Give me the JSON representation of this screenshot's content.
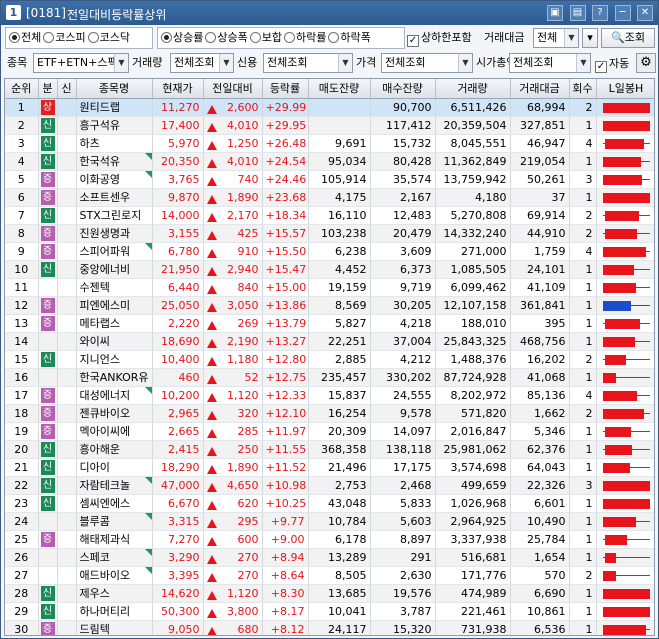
{
  "window": {
    "number": "1",
    "code": "[0181]",
    "title": "전일대비등락률상위",
    "buttons": [
      "▣",
      "▤",
      "?",
      "─",
      "✕"
    ]
  },
  "filters": {
    "market_options": [
      "전체",
      "코스피",
      "코스닥"
    ],
    "market_selected": 0,
    "sort_options": [
      "상승률",
      "상승폭",
      "보합",
      "하락률",
      "하락폭"
    ],
    "sort_selected": 0,
    "include_limit_label": "상하한포함",
    "include_limit_checked": true,
    "trade_amount_label": "거래대금",
    "trade_amount_value": "전체",
    "query_button": "조회",
    "item_label": "종목",
    "item_value": "ETF+ETN+스팩",
    "volume_label": "거래량",
    "volume_value": "전체조회",
    "credit_label": "신용",
    "credit_value": "전체조회",
    "price_label": "가격",
    "price_value": "전체조회",
    "mcap_label": "시가총액",
    "mcap_value": "전체조회",
    "auto_label": "자동",
    "auto_checked": true
  },
  "columns": [
    "순위",
    "분",
    "신",
    "종목명",
    "현재가",
    "전일대비",
    "등락률",
    "매도잔량",
    "매수잔량",
    "거래량",
    "거래대금",
    "회수",
    "L일봉H"
  ],
  "colors": {
    "up": "#e8131b",
    "candle_blue": "#1a4fc9",
    "tag_up": "#e02020",
    "tag_new": "#1b8a5a",
    "tag_mid": "#b65fb0"
  },
  "rows": [
    {
      "rank": "1",
      "tag": "상",
      "tag_kind": "up",
      "name": "원티드랩",
      "price": "11,270",
      "change": "2,600",
      "rate": "+29.99",
      "ask": "",
      "bid": "90,700",
      "volume": "6,511,426",
      "amount": "68,994",
      "count": "2",
      "tri": false,
      "candle": [
        0.05,
        0.98,
        0.05,
        0.98
      ],
      "blue": false
    },
    {
      "rank": "2",
      "tag": "신",
      "tag_kind": "new",
      "name": "흥구석유",
      "price": "17,400",
      "change": "4,010",
      "rate": "+29.95",
      "ask": "",
      "bid": "117,412",
      "volume": "20,359,504",
      "amount": "327,851",
      "count": "1",
      "tri": false,
      "candle": [
        0.05,
        0.98,
        0.05,
        0.98
      ],
      "blue": false
    },
    {
      "rank": "3",
      "tag": "신",
      "tag_kind": "new",
      "name": "하츠",
      "price": "5,970",
      "change": "1,250",
      "rate": "+26.48",
      "ask": "9,691",
      "bid": "15,732",
      "volume": "8,045,551",
      "amount": "46,947",
      "count": "4",
      "tri": false,
      "candle": [
        0.05,
        0.98,
        0.08,
        0.85
      ],
      "blue": false
    },
    {
      "rank": "4",
      "tag": "신",
      "tag_kind": "new",
      "name": "한국석유",
      "price": "20,350",
      "change": "4,010",
      "rate": "+24.54",
      "ask": "95,034",
      "bid": "80,428",
      "volume": "11,362,849",
      "amount": "219,054",
      "count": "1",
      "tri": true,
      "candle": [
        0.05,
        0.98,
        0.05,
        0.8
      ],
      "blue": false
    },
    {
      "rank": "5",
      "tag": "증",
      "tag_kind": "mid",
      "name": "이화공영",
      "price": "3,765",
      "change": "740",
      "rate": "+24.46",
      "ask": "105,914",
      "bid": "35,574",
      "volume": "13,759,942",
      "amount": "50,261",
      "count": "3",
      "tri": true,
      "candle": [
        0.05,
        0.98,
        0.05,
        0.82
      ],
      "blue": false
    },
    {
      "rank": "6",
      "tag": "증",
      "tag_kind": "mid",
      "name": "소프트센우",
      "price": "9,870",
      "change": "1,890",
      "rate": "+23.68",
      "ask": "4,175",
      "bid": "2,167",
      "volume": "4,180",
      "amount": "37",
      "count": "1",
      "tri": false,
      "candle": [
        0.05,
        0.98,
        0.05,
        0.98
      ],
      "blue": false
    },
    {
      "rank": "7",
      "tag": "신",
      "tag_kind": "new",
      "name": "STX그린로지",
      "price": "14,000",
      "change": "2,170",
      "rate": "+18.34",
      "ask": "16,110",
      "bid": "12,483",
      "volume": "5,270,808",
      "amount": "69,914",
      "count": "2",
      "tri": false,
      "candle": [
        0.05,
        0.98,
        0.08,
        0.75
      ],
      "blue": false
    },
    {
      "rank": "8",
      "tag": "증",
      "tag_kind": "mid",
      "name": "진원생명과",
      "price": "3,155",
      "change": "425",
      "rate": "+15.57",
      "ask": "103,238",
      "bid": "20,479",
      "volume": "14,332,240",
      "amount": "44,910",
      "count": "2",
      "tri": false,
      "candle": [
        0.05,
        0.98,
        0.08,
        0.72
      ],
      "blue": false
    },
    {
      "rank": "9",
      "tag": "증",
      "tag_kind": "mid",
      "name": "스피어파워",
      "price": "6,780",
      "change": "910",
      "rate": "+15.50",
      "ask": "6,238",
      "bid": "3,609",
      "volume": "271,000",
      "amount": "1,759",
      "count": "4",
      "tri": true,
      "candle": [
        0.05,
        0.98,
        0.05,
        0.9
      ],
      "blue": false
    },
    {
      "rank": "10",
      "tag": "신",
      "tag_kind": "new",
      "name": "중앙에너비",
      "price": "21,950",
      "change": "2,940",
      "rate": "+15.47",
      "ask": "4,452",
      "bid": "6,373",
      "volume": "1,085,505",
      "amount": "24,101",
      "count": "1",
      "tri": false,
      "candle": [
        0.05,
        0.98,
        0.05,
        0.65
      ],
      "blue": false
    },
    {
      "rank": "11",
      "tag": "",
      "tag_kind": "",
      "name": "수젠텍",
      "price": "6,440",
      "change": "840",
      "rate": "+15.00",
      "ask": "19,159",
      "bid": "9,719",
      "volume": "6,099,462",
      "amount": "41,109",
      "count": "1",
      "tri": false,
      "candle": [
        0.05,
        0.98,
        0.05,
        0.7
      ],
      "blue": false
    },
    {
      "rank": "12",
      "tag": "증",
      "tag_kind": "mid",
      "name": "피엔에스미",
      "price": "25,050",
      "change": "3,050",
      "rate": "+13.86",
      "ask": "8,569",
      "bid": "30,205",
      "volume": "12,107,158",
      "amount": "361,841",
      "count": "1",
      "tri": false,
      "candle": [
        0.05,
        0.98,
        0.05,
        0.6
      ],
      "blue": true
    },
    {
      "rank": "13",
      "tag": "증",
      "tag_kind": "mid",
      "name": "메타랩스",
      "price": "2,220",
      "change": "269",
      "rate": "+13.79",
      "ask": "5,827",
      "bid": "4,218",
      "volume": "188,010",
      "amount": "395",
      "count": "1",
      "tri": false,
      "candle": [
        0.05,
        0.98,
        0.08,
        0.78
      ],
      "blue": false
    },
    {
      "rank": "14",
      "tag": "",
      "tag_kind": "",
      "name": "와이씨",
      "price": "18,690",
      "change": "2,190",
      "rate": "+13.27",
      "ask": "22,251",
      "bid": "37,004",
      "volume": "25,843,325",
      "amount": "468,756",
      "count": "1",
      "tri": false,
      "candle": [
        0.05,
        0.98,
        0.05,
        0.68
      ],
      "blue": false
    },
    {
      "rank": "15",
      "tag": "신",
      "tag_kind": "new",
      "name": "지니언스",
      "price": "10,400",
      "change": "1,180",
      "rate": "+12.80",
      "ask": "2,885",
      "bid": "4,212",
      "volume": "1,488,376",
      "amount": "16,202",
      "count": "2",
      "tri": false,
      "candle": [
        0.05,
        0.98,
        0.08,
        0.5
      ],
      "blue": false
    },
    {
      "rank": "16",
      "tag": "",
      "tag_kind": "",
      "name": "한국ANKOR유",
      "price": "460",
      "change": "52",
      "rate": "+12.75",
      "ask": "235,457",
      "bid": "330,202",
      "volume": "87,724,928",
      "amount": "41,068",
      "count": "1",
      "tri": false,
      "candle": [
        0.05,
        0.98,
        0.05,
        0.3
      ],
      "blue": false
    },
    {
      "rank": "17",
      "tag": "증",
      "tag_kind": "mid",
      "name": "대성에너지",
      "price": "10,200",
      "change": "1,120",
      "rate": "+12.33",
      "ask": "15,837",
      "bid": "24,555",
      "volume": "8,202,972",
      "amount": "85,136",
      "count": "4",
      "tri": true,
      "candle": [
        0.05,
        0.98,
        0.05,
        0.72
      ],
      "blue": false
    },
    {
      "rank": "18",
      "tag": "증",
      "tag_kind": "mid",
      "name": "젠큐바이오",
      "price": "2,965",
      "change": "320",
      "rate": "+12.10",
      "ask": "16,254",
      "bid": "9,578",
      "volume": "571,820",
      "amount": "1,662",
      "count": "2",
      "tri": false,
      "candle": [
        0.05,
        0.98,
        0.05,
        0.85
      ],
      "blue": false
    },
    {
      "rank": "19",
      "tag": "증",
      "tag_kind": "mid",
      "name": "멕아이씨에",
      "price": "2,665",
      "change": "285",
      "rate": "+11.97",
      "ask": "20,309",
      "bid": "14,097",
      "volume": "2,016,847",
      "amount": "5,346",
      "count": "1",
      "tri": false,
      "candle": [
        0.05,
        0.98,
        0.08,
        0.6
      ],
      "blue": false
    },
    {
      "rank": "20",
      "tag": "신",
      "tag_kind": "new",
      "name": "흥아해운",
      "price": "2,415",
      "change": "250",
      "rate": "+11.55",
      "ask": "368,358",
      "bid": "138,118",
      "volume": "25,981,062",
      "amount": "62,376",
      "count": "1",
      "tri": false,
      "candle": [
        0.05,
        0.98,
        0.08,
        0.62
      ],
      "blue": false
    },
    {
      "rank": "21",
      "tag": "신",
      "tag_kind": "new",
      "name": "디아이",
      "price": "18,290",
      "change": "1,890",
      "rate": "+11.52",
      "ask": "21,496",
      "bid": "17,175",
      "volume": "3,574,698",
      "amount": "64,043",
      "count": "1",
      "tri": false,
      "candle": [
        0.05,
        0.98,
        0.05,
        0.58
      ],
      "blue": false
    },
    {
      "rank": "22",
      "tag": "신",
      "tag_kind": "new",
      "name": "자람테크놀",
      "price": "47,000",
      "change": "4,650",
      "rate": "+10.98",
      "ask": "2,753",
      "bid": "2,468",
      "volume": "499,659",
      "amount": "22,326",
      "count": "3",
      "tri": true,
      "candle": [
        0.05,
        0.98,
        0.05,
        0.98
      ],
      "blue": false
    },
    {
      "rank": "23",
      "tag": "신",
      "tag_kind": "new",
      "name": "셈씨엔에스",
      "price": "6,670",
      "change": "620",
      "rate": "+10.25",
      "ask": "43,048",
      "bid": "5,833",
      "volume": "1,026,968",
      "amount": "6,601",
      "count": "1",
      "tri": false,
      "candle": [
        0.05,
        0.98,
        0.05,
        0.98
      ],
      "blue": false
    },
    {
      "rank": "24",
      "tag": "",
      "tag_kind": "",
      "name": "블루콤",
      "price": "3,315",
      "change": "295",
      "rate": "+9.77",
      "ask": "10,784",
      "bid": "5,603",
      "volume": "2,964,925",
      "amount": "10,490",
      "count": "1",
      "tri": true,
      "candle": [
        0.05,
        0.98,
        0.05,
        0.7
      ],
      "blue": false
    },
    {
      "rank": "25",
      "tag": "증",
      "tag_kind": "mid",
      "name": "해태제과식",
      "price": "7,270",
      "change": "600",
      "rate": "+9.00",
      "ask": "6,178",
      "bid": "8,897",
      "volume": "3,337,938",
      "amount": "25,784",
      "count": "1",
      "tri": false,
      "candle": [
        0.05,
        0.98,
        0.08,
        0.52
      ],
      "blue": false
    },
    {
      "rank": "26",
      "tag": "",
      "tag_kind": "",
      "name": "스페코",
      "price": "3,290",
      "change": "270",
      "rate": "+8.94",
      "ask": "13,289",
      "bid": "291",
      "volume": "516,681",
      "amount": "1,654",
      "count": "1",
      "tri": true,
      "candle": [
        0.05,
        0.98,
        0.08,
        0.3
      ],
      "blue": false
    },
    {
      "rank": "27",
      "tag": "",
      "tag_kind": "",
      "name": "애드바이오",
      "price": "3,395",
      "change": "270",
      "rate": "+8.64",
      "ask": "8,505",
      "bid": "2,630",
      "volume": "171,776",
      "amount": "570",
      "count": "2",
      "tri": true,
      "candle": [
        0.05,
        0.98,
        0.05,
        0.3
      ],
      "blue": false
    },
    {
      "rank": "28",
      "tag": "신",
      "tag_kind": "new",
      "name": "제우스",
      "price": "14,620",
      "change": "1,120",
      "rate": "+8.30",
      "ask": "13,685",
      "bid": "19,576",
      "volume": "474,989",
      "amount": "6,690",
      "count": "1",
      "tri": false,
      "candle": [
        0.05,
        0.98,
        0.05,
        0.98
      ],
      "blue": false
    },
    {
      "rank": "29",
      "tag": "신",
      "tag_kind": "new",
      "name": "하나머티리",
      "price": "50,300",
      "change": "3,800",
      "rate": "+8.17",
      "ask": "10,041",
      "bid": "3,787",
      "volume": "221,461",
      "amount": "10,861",
      "count": "1",
      "tri": false,
      "candle": [
        0.05,
        0.98,
        0.05,
        0.98
      ],
      "blue": false
    },
    {
      "rank": "30",
      "tag": "증",
      "tag_kind": "mid",
      "name": "드림텍",
      "price": "9,050",
      "change": "680",
      "rate": "+8.12",
      "ask": "24,117",
      "bid": "15,320",
      "volume": "731,938",
      "amount": "6,536",
      "count": "1",
      "tri": false,
      "candle": [
        0.05,
        0.98,
        0.05,
        0.9
      ],
      "blue": false
    }
  ]
}
